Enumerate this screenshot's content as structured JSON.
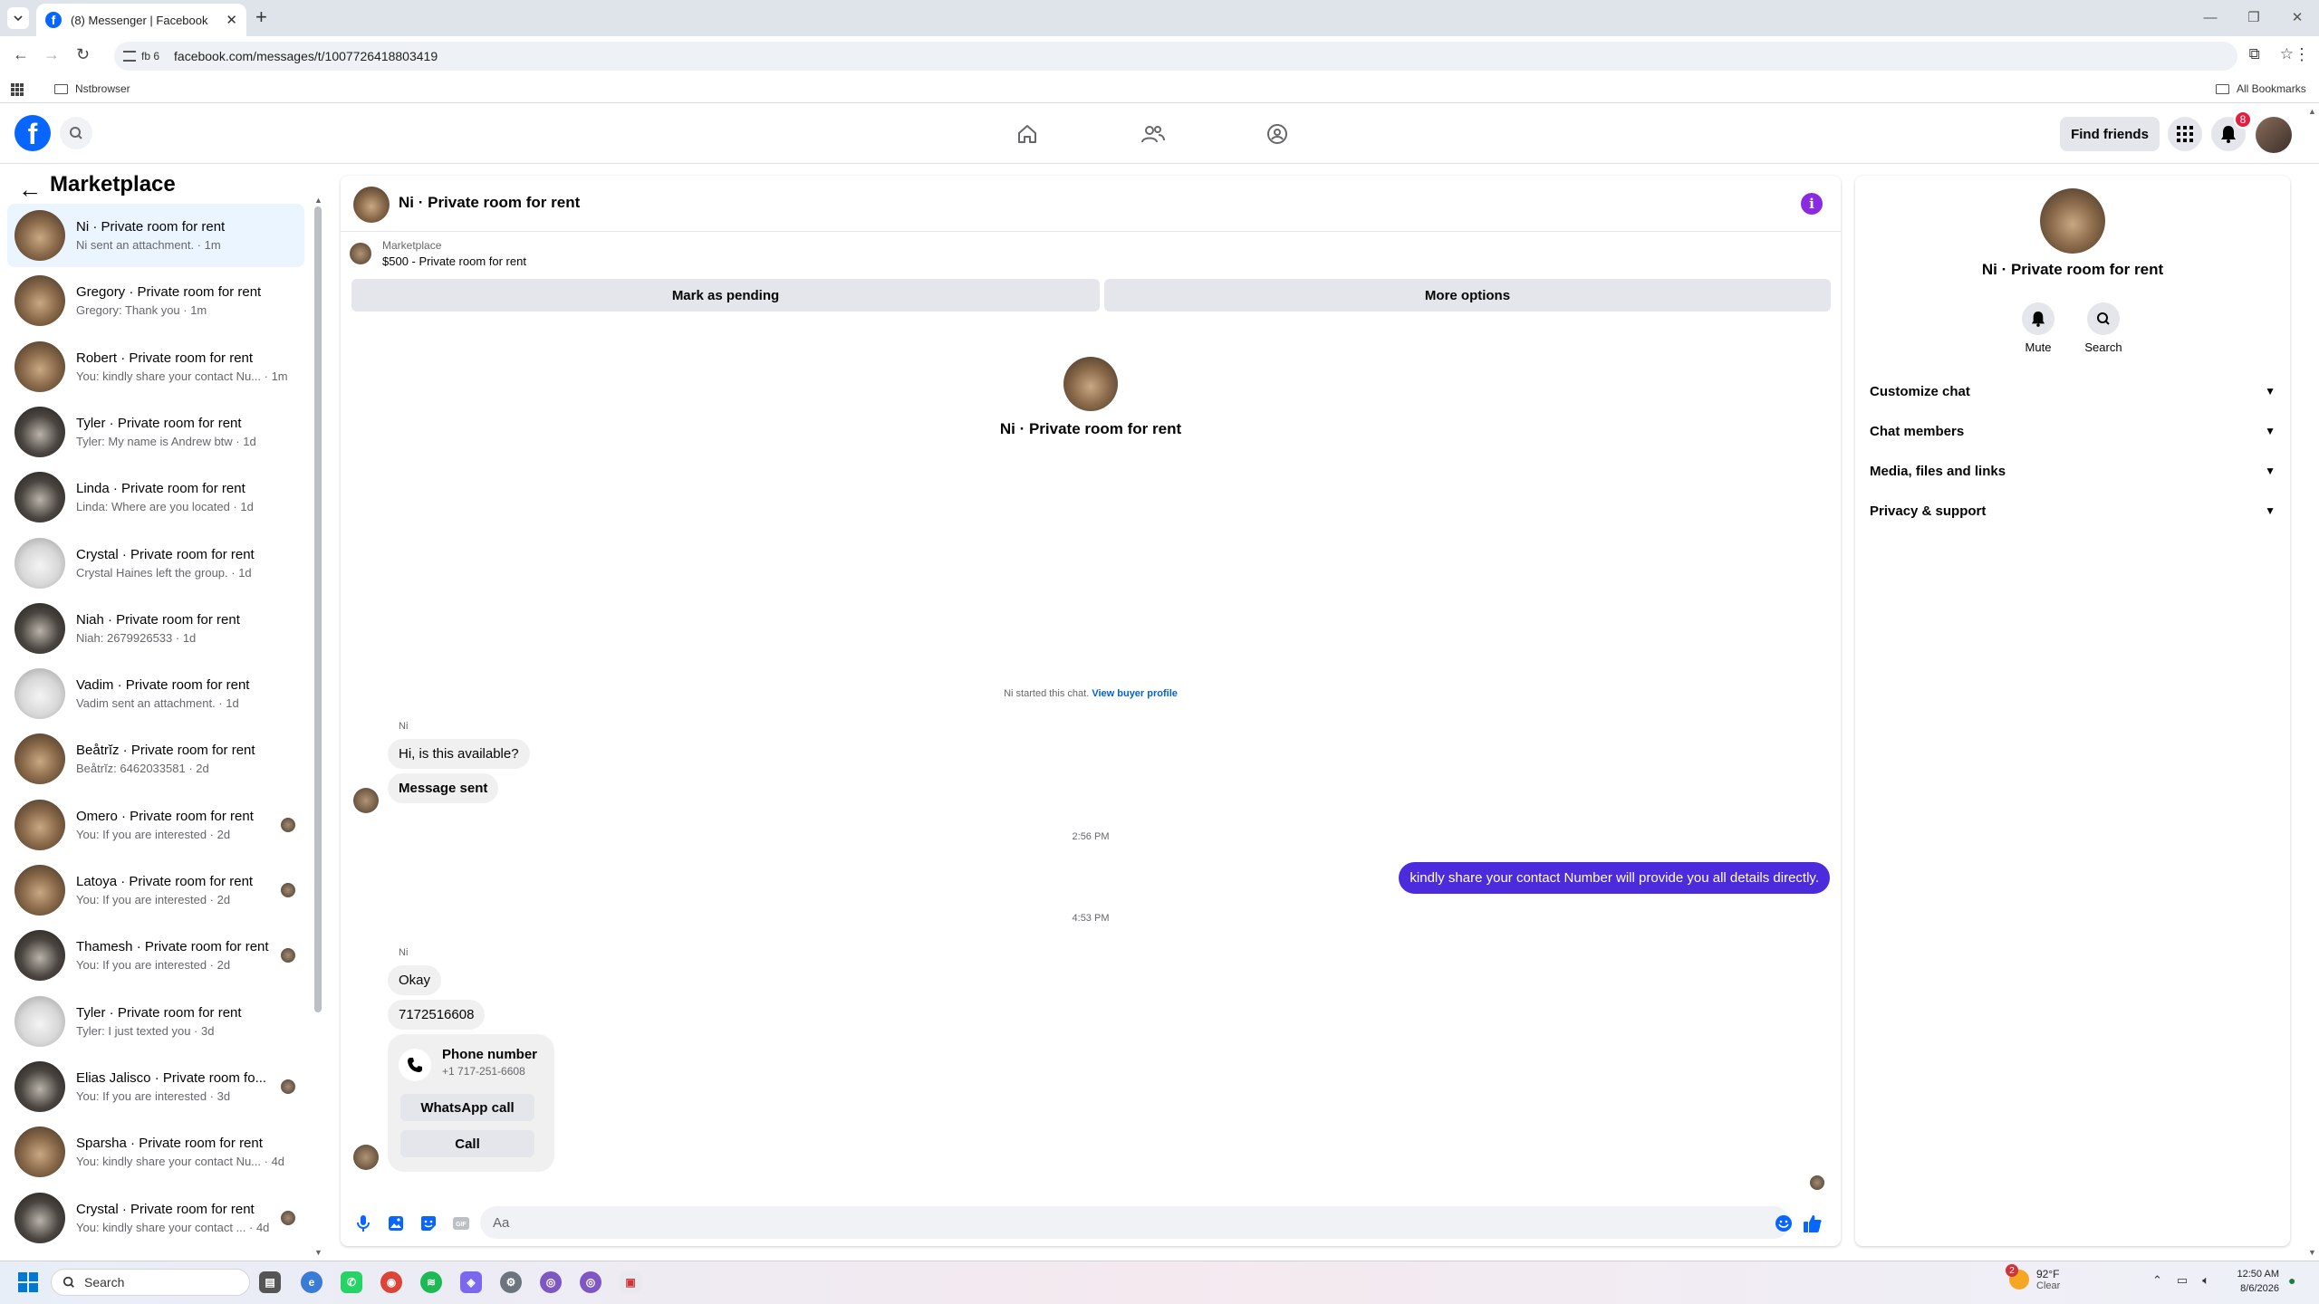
{
  "browser": {
    "tab_title": "(8) Messenger | Facebook",
    "profile_chip": "fb 6",
    "url": "facebook.com/messages/t/1007726418803419",
    "bookmark_folder": "Nstbrowser",
    "all_bookmarks": "All Bookmarks"
  },
  "fb_header": {
    "find_friends": "Find friends",
    "notification_count": "8"
  },
  "sidebar": {
    "title": "Marketplace",
    "conversations": [
      {
        "name": "Ni · Private room for rent",
        "snippet": "Ni sent an attachment. · 1m",
        "avatar": "brown",
        "active": true
      },
      {
        "name": "Gregory · Private room for rent",
        "snippet": "Gregory: Thank you · 1m",
        "avatar": "brown"
      },
      {
        "name": "Robert · Private room for rent",
        "snippet": "You: kindly share your contact Nu... · 1m",
        "avatar": "brown"
      },
      {
        "name": "Tyler · Private room for rent",
        "snippet": "Tyler: My name is Andrew btw · 1d",
        "avatar": "dark"
      },
      {
        "name": "Linda · Private room for rent",
        "snippet": "Linda: Where are you located · 1d",
        "avatar": "dark"
      },
      {
        "name": "Crystal · Private room for rent",
        "snippet": "Crystal Haines left the group. · 1d",
        "avatar": "light"
      },
      {
        "name": "Niah · Private room for rent",
        "snippet": "Niah: 2679926533 · 1d",
        "avatar": "dark"
      },
      {
        "name": "Vadim · Private room for rent",
        "snippet": "Vadim sent an attachment. · 1d",
        "avatar": "light"
      },
      {
        "name": "Beåtrĭz · Private room for rent",
        "snippet": "Beåtrĭz: 6462033581 · 2d",
        "avatar": "brown"
      },
      {
        "name": "Omero · Private room for rent",
        "snippet": "You: If you are interested · 2d",
        "avatar": "brown",
        "seen": true
      },
      {
        "name": "Latoya · Private room for rent",
        "snippet": "You: If you are interested · 2d",
        "avatar": "brown",
        "seen": true
      },
      {
        "name": "Thamesh · Private room for rent",
        "snippet": "You: If you are interested · 2d",
        "avatar": "dark",
        "seen": true
      },
      {
        "name": "Tyler · Private room for rent",
        "snippet": "Tyler: I just texted you · 3d",
        "avatar": "light"
      },
      {
        "name": "Elias Jalisco · Private room fo...",
        "snippet": "You: If you are interested · 3d",
        "avatar": "dark",
        "seen": true
      },
      {
        "name": "Sparsha · Private room for rent",
        "snippet": "You: kindly share your contact Nu... · 4d",
        "avatar": "brown"
      },
      {
        "name": "Crystal · Private room for rent",
        "snippet": "You: kindly share your contact ... · 4d",
        "avatar": "dark",
        "seen": true
      }
    ]
  },
  "chat": {
    "title": "Ni · Private room for rent",
    "listing_source": "Marketplace",
    "listing_price_title": "$500 - Private room for rent",
    "mark_pending": "Mark as pending",
    "more_options": "More options",
    "intro_name": "Ni · Private room for rent",
    "started_text": "Ni started this chat.",
    "view_buyer_profile": "View buyer profile",
    "sender_name": "Ni",
    "msg_available": "Hi, is this available?",
    "msg_sent": "Message sent",
    "time_1": "2:56 PM",
    "msg_out": "kindly share your contact Number will provide you all details directly.",
    "time_2": "4:53 PM",
    "msg_okay": "Okay",
    "msg_number": "7172516608",
    "phone_label": "Phone number",
    "phone_value": "+1 717-251-6608",
    "whatsapp_call": "WhatsApp call",
    "call": "Call",
    "composer_placeholder": "Aa"
  },
  "details": {
    "name": "Ni · Private room for rent",
    "mute": "Mute",
    "search": "Search",
    "sections": [
      "Customize chat",
      "Chat members",
      "Media, files and links",
      "Privacy & support"
    ]
  },
  "taskbar": {
    "search_placeholder": "Search",
    "weather_badge": "2",
    "temp": "92°F",
    "condition": "Clear",
    "time": "12:50 AM",
    "date": "8/6/2026"
  },
  "colors": {
    "fb_blue": "#0866ff",
    "outgoing_bubble": "#4b2bdb",
    "active_row": "#ebf5ff",
    "info_icon": "#8a2be2"
  }
}
